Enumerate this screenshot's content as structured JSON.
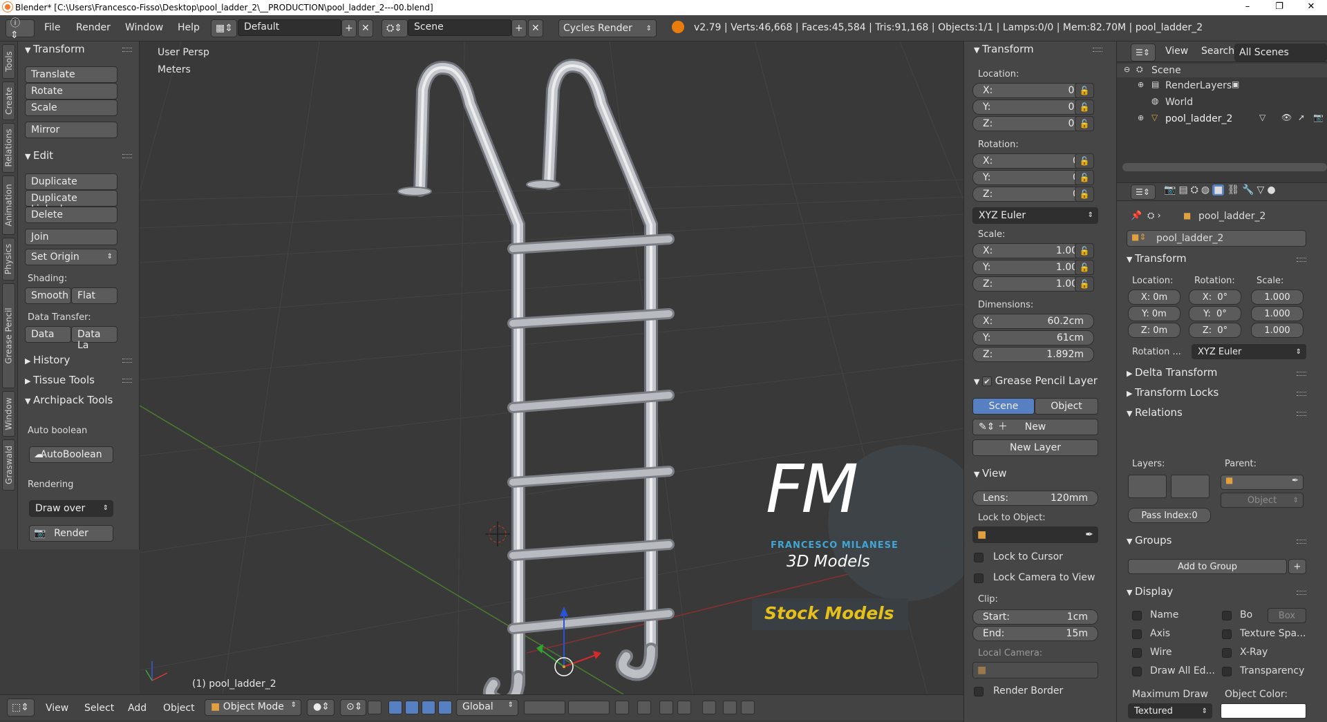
{
  "window": {
    "title": "Blender* [C:\\Users\\Francesco-Fisso\\Desktop\\pool_ladder_2\\__PRODUCTION\\pool_ladder_2---00.blend]",
    "minimize": "–",
    "maximize": "❐",
    "close": "✕"
  },
  "menubar": {
    "items": [
      "File",
      "Render",
      "Window",
      "Help"
    ],
    "layout": "Default",
    "scene": "Scene",
    "engine": "Cycles Render",
    "stats": "v2.79 | Verts:46,668 | Faces:45,584 | Tris:91,168 | Objects:1/1 | Lamps:0/0 | Mem:82.70M | pool_ladder_2"
  },
  "sidetabs": [
    "Tools",
    "Create",
    "Relations",
    "Animation",
    "Physics",
    "Grease Pencil",
    "Window",
    "Graswald"
  ],
  "toolshelf": {
    "transform_header": "Transform",
    "translate": "Translate",
    "rotate": "Rotate",
    "scale": "Scale",
    "mirror": "Mirror",
    "edit_header": "Edit",
    "duplicate": "Duplicate",
    "duplicate_linked": "Duplicate Linked",
    "delete": "Delete",
    "join": "Join",
    "set_origin": "Set Origin",
    "shading_label": "Shading:",
    "smooth": "Smooth",
    "flat": "Flat",
    "data_transfer_label": "Data Transfer:",
    "data": "Data",
    "data_la": "Data La",
    "history": "History",
    "tissue": "Tissue Tools",
    "archipack": "Archipack Tools",
    "auto_boolean_label": "Auto boolean",
    "auto_boolean_btn": "AutoBoolean",
    "rendering_label": "Rendering",
    "draw_over": "Draw over",
    "render_btn": "Render"
  },
  "viewport": {
    "view_name": "User Persp",
    "units": "Meters",
    "object_label": "(1) pool_ladder_2",
    "watermark_fm": "FM",
    "watermark_name": "FRANCESCO MILANESE",
    "watermark_3d": "3D Models",
    "watermark_stock": "Stock Models"
  },
  "npanel": {
    "transform_header": "Transform",
    "location_label": "Location:",
    "loc": [
      {
        "axis": "X:",
        "value": "0m"
      },
      {
        "axis": "Y:",
        "value": "0m"
      },
      {
        "axis": "Z:",
        "value": "0m"
      }
    ],
    "rotation_label": "Rotation:",
    "rot": [
      {
        "axis": "X:",
        "value": "0°"
      },
      {
        "axis": "Y:",
        "value": "0°"
      },
      {
        "axis": "Z:",
        "value": "0°"
      }
    ],
    "rotation_mode": "XYZ Euler",
    "scale_label": "Scale:",
    "scale": [
      {
        "axis": "X:",
        "value": "1.000"
      },
      {
        "axis": "Y:",
        "value": "1.000"
      },
      {
        "axis": "Z:",
        "value": "1.000"
      }
    ],
    "dimensions_label": "Dimensions:",
    "dims": [
      {
        "axis": "X:",
        "value": "60.2cm"
      },
      {
        "axis": "Y:",
        "value": "61cm"
      },
      {
        "axis": "Z:",
        "value": "1.892m"
      }
    ],
    "grease_header": "Grease Pencil Layer",
    "gp_scene": "Scene",
    "gp_object": "Object",
    "gp_new": "New",
    "gp_new_layer": "New Layer",
    "view_header": "View",
    "lens_label": "Lens:",
    "lens_value": "120mm",
    "lock_to_object": "Lock to Object:",
    "lock_cursor": "Lock to Cursor",
    "lock_camera": "Lock Camera to View",
    "clip_label": "Clip:",
    "clip_start_label": "Start:",
    "clip_start": "1cm",
    "clip_end_label": "End:",
    "clip_end": "15m",
    "local_camera": "Local Camera:",
    "render_border": "Render Border"
  },
  "outliner": {
    "view": "View",
    "search": "Search",
    "scope": "All Scenes",
    "scene": "Scene",
    "render_layers": "RenderLayers",
    "world": "World",
    "object": "pool_ladder_2"
  },
  "properties": {
    "breadcrumb": "pool_ladder_2",
    "object_name": "pool_ladder_2",
    "transform_header": "Transform",
    "location": "Location:",
    "rotation": "Rotation:",
    "scale": "Scale:",
    "loc": [
      "X: 0m",
      "Y: 0m",
      "Z: 0m"
    ],
    "rot": [
      "X:",
      "Y:",
      "Z:"
    ],
    "rot_vals": [
      "0°",
      "0°",
      "0°"
    ],
    "scl": [
      "1.000",
      "1.000",
      "1.000"
    ],
    "rotation_mode_label": "Rotation ...",
    "rotation_mode": "XYZ Euler",
    "delta": "Delta Transform",
    "locks": "Transform Locks",
    "relations": "Relations",
    "layers": "Layers:",
    "parent": "Parent:",
    "parent_type": "Object",
    "pass_index": "Pass Index:0",
    "groups": "Groups",
    "add_to_group": "Add to Group",
    "display": "Display",
    "name": "Name",
    "axis": "Axis",
    "wire": "Wire",
    "draw_all": "Draw All Ed...",
    "bo": "Bo",
    "box": "Box",
    "texture_space": "Texture Spa...",
    "xray": "X-Ray",
    "transparency": "Transparency",
    "max_draw": "Maximum Draw",
    "object_color": "Object Color:",
    "textured": "Textured"
  },
  "bottombar": {
    "view": "View",
    "select": "Select",
    "add": "Add",
    "object": "Object",
    "mode": "Object Mode",
    "orientation": "Global"
  }
}
